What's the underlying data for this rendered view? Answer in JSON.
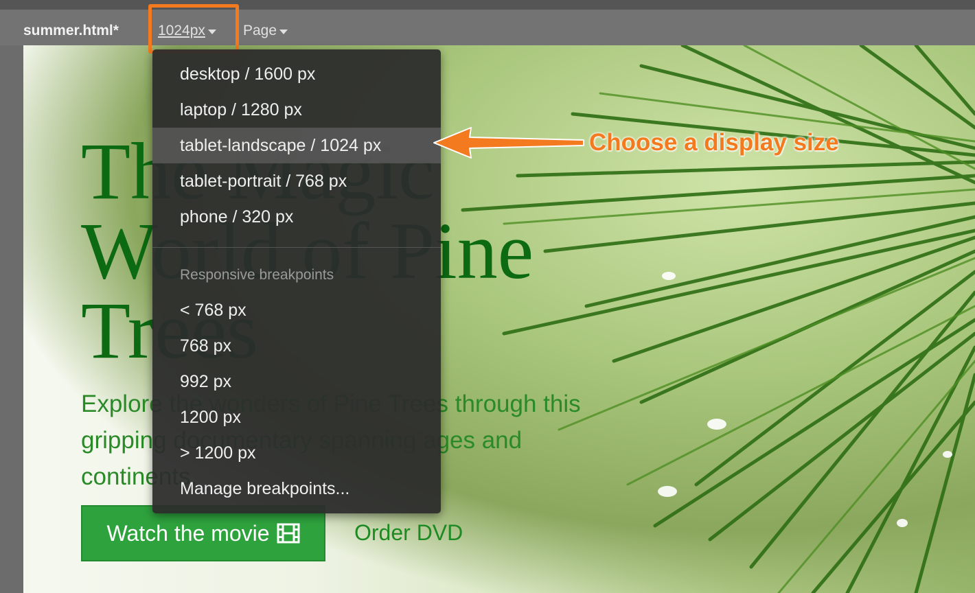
{
  "toolbar": {
    "document_title": "summer.html*",
    "size_selector_label": "1024px",
    "page_menu_label": "Page"
  },
  "dropdown": {
    "device_sizes": [
      {
        "label": "desktop / 1600 px",
        "selected": false
      },
      {
        "label": "laptop / 1280 px",
        "selected": false
      },
      {
        "label": "tablet-landscape / 1024 px",
        "selected": true
      },
      {
        "label": "tablet-portrait / 768 px",
        "selected": false
      },
      {
        "label": "phone / 320 px",
        "selected": false
      }
    ],
    "breakpoints_header": "Responsive breakpoints",
    "breakpoints": [
      {
        "label": "< 768 px"
      },
      {
        "label": "768 px"
      },
      {
        "label": "992 px"
      },
      {
        "label": "1200 px"
      },
      {
        "label": "> 1200 px"
      }
    ],
    "manage_label": "Manage breakpoints..."
  },
  "page": {
    "hero_title_line1": "The Magic",
    "hero_title_line2": "World of Pine",
    "hero_title_line3": "Trees",
    "hero_subtitle": "Explore the wonders of Pine Trees through this gripping documentary spanning ages and continents.",
    "watch_button_label": "Watch the movie",
    "order_link_label": "Order DVD"
  },
  "annotation": {
    "callout_text": "Choose a display size"
  },
  "icons": {
    "film": "film-icon",
    "caret": "chevron-down-icon"
  },
  "colors": {
    "accent_orange": "#f47a1f",
    "hero_green": "#0b6a12",
    "button_green": "#2ea33d"
  }
}
